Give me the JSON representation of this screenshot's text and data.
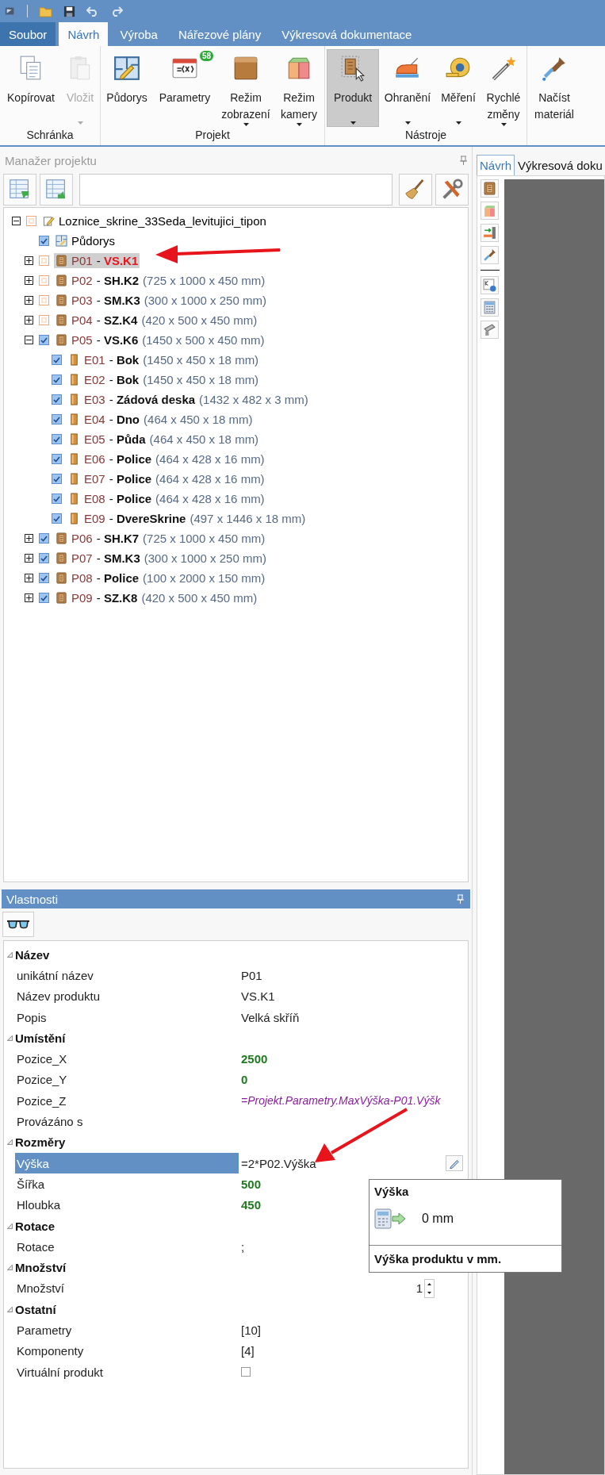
{
  "menu_tabs": [
    {
      "label": "Soubor",
      "kind": "file",
      "selected": false
    },
    {
      "label": "Návrh",
      "kind": "tab",
      "selected": true
    },
    {
      "label": "Výroba",
      "kind": "tab",
      "selected": false
    },
    {
      "label": "Nářezové plány",
      "kind": "tab",
      "selected": false
    },
    {
      "label": "Výkresová dokumentace",
      "kind": "tab",
      "selected": false
    }
  ],
  "ribbon_groups": [
    {
      "label": "Schránka",
      "buttons": [
        {
          "label": "Kopírovat",
          "selected": false,
          "disabled": false,
          "dropdown": false
        },
        {
          "label": "Vložit",
          "selected": false,
          "disabled": true,
          "dropdown": true
        }
      ]
    },
    {
      "label": "Projekt",
      "buttons": [
        {
          "label": "Půdorys",
          "selected": false,
          "disabled": false,
          "dropdown": false
        },
        {
          "label": "Parametry",
          "badge": "58",
          "selected": false,
          "disabled": false,
          "dropdown": false
        },
        {
          "label": "Režim zobrazení",
          "selected": false,
          "disabled": false,
          "dropdown": true
        },
        {
          "label": "Režim kamery",
          "selected": false,
          "disabled": false,
          "dropdown": true
        }
      ]
    },
    {
      "label": "Nástroje",
      "buttons": [
        {
          "label": "Produkt",
          "selected": true,
          "disabled": false,
          "dropdown": true
        },
        {
          "label": "Ohranění",
          "selected": false,
          "disabled": false,
          "dropdown": true
        },
        {
          "label": "Měření",
          "selected": false,
          "disabled": false,
          "dropdown": true
        },
        {
          "label": "Rychlé změny",
          "selected": false,
          "disabled": false,
          "dropdown": true
        }
      ]
    },
    {
      "buttons": [
        {
          "label": "Načíst materiál",
          "selected": false,
          "disabled": false,
          "dropdown": false
        }
      ]
    }
  ],
  "project_manager": {
    "title": "Manažer projektu",
    "tree": {
      "kind": "project",
      "label": "Loznice_skrine_33Seda_levitujici_tipon",
      "checked": false,
      "expanded": true,
      "selected": false,
      "children": [
        {
          "kind": "plan",
          "label": "Půdorys",
          "checked": true,
          "selected": false
        },
        {
          "kind": "product",
          "code": "P01",
          "title": "- **VS.K1**",
          "checked": false,
          "expanded": false,
          "selected": true
        },
        {
          "kind": "product",
          "code": "P02",
          "title": "- **SH.K2**",
          "size": "(725 x 1000 x 450 mm)",
          "checked": false,
          "expanded": false,
          "selected": false
        },
        {
          "kind": "product",
          "code": "P03",
          "title": "- **SM.K3**",
          "size": "(300 x 1000 x 250 mm)",
          "checked": false,
          "expanded": false,
          "selected": false
        },
        {
          "kind": "product",
          "code": "P04",
          "title": "- **SZ.K4**",
          "size": "(420 x 500 x 450 mm)",
          "checked": false,
          "expanded": false,
          "selected": false
        },
        {
          "kind": "product",
          "code": "P05",
          "title": "- **VS.K6**",
          "size": "(1450 x 500 x 450 mm)",
          "checked": true,
          "expanded": true,
          "selected": false,
          "children": [
            {
              "kind": "part",
              "code": "E01",
              "title": "- **Bok**",
              "size": "(1450 x 450 x 18 mm)",
              "checked": true,
              "selected": false
            },
            {
              "kind": "part",
              "code": "E02",
              "title": "- **Bok**",
              "size": "(1450 x 450 x 18 mm)",
              "checked": true,
              "selected": false
            },
            {
              "kind": "part",
              "code": "E03",
              "title": "- **Zádová deska**",
              "size": "(1432 x 482 x 3 mm)",
              "checked": true,
              "selected": false
            },
            {
              "kind": "part",
              "code": "E04",
              "title": "- **Dno**",
              "size": "(464 x 450 x 18 mm)",
              "checked": true,
              "selected": false
            },
            {
              "kind": "part",
              "code": "E05",
              "title": "- **Půda**",
              "size": "(464 x 450 x 18 mm)",
              "checked": true,
              "selected": false
            },
            {
              "kind": "part",
              "code": "E06",
              "title": "- **Police**",
              "size": "(464 x 428 x 16 mm)",
              "checked": true,
              "selected": false
            },
            {
              "kind": "part",
              "code": "E07",
              "title": "- **Police**",
              "size": "(464 x 428 x 16 mm)",
              "checked": true,
              "selected": false
            },
            {
              "kind": "part",
              "code": "E08",
              "title": "- **Police**",
              "size": "(464 x 428 x 16 mm)",
              "checked": true,
              "selected": false
            },
            {
              "kind": "part",
              "code": "E09",
              "title": "- **DvereSkrine**",
              "size": "(497 x 1446 x 18 mm)",
              "checked": true,
              "selected": false
            }
          ]
        },
        {
          "kind": "product",
          "code": "P06",
          "title": "- **SH.K7**",
          "size": "(725 x 1000 x 450 mm)",
          "checked": true,
          "expanded": false,
          "selected": false
        },
        {
          "kind": "product",
          "code": "P07",
          "title": "- **SM.K3**",
          "size": "(300 x 1000 x 250 mm)",
          "checked": true,
          "expanded": false,
          "selected": false
        },
        {
          "kind": "product",
          "code": "P08",
          "title": "- **Police**",
          "size": "(100 x 2000 x 150 mm)",
          "checked": true,
          "expanded": false,
          "selected": false
        },
        {
          "kind": "product",
          "code": "P09",
          "title": "- **SZ.K8**",
          "size": "(420 x 500 x 450 mm)",
          "checked": true,
          "expanded": false,
          "selected": false
        }
      ]
    }
  },
  "properties": {
    "title": "Vlastnosti",
    "categories": [
      {
        "label": "Název",
        "expanded": true,
        "rows": [
          {
            "name": "unikátní název",
            "kind": "text",
            "value": "P01",
            "selected": false
          },
          {
            "name": "Název produktu",
            "kind": "text",
            "value": "VS.K1",
            "selected": false
          },
          {
            "name": "Popis",
            "kind": "text",
            "value": "Velká skříň",
            "selected": false
          }
        ]
      },
      {
        "label": "Umístění",
        "expanded": true,
        "rows": [
          {
            "name": "Pozice_X",
            "kind": "number",
            "value": "2500",
            "selected": false
          },
          {
            "name": "Pozice_Y",
            "kind": "number",
            "value": "0",
            "selected": false
          },
          {
            "name": "Pozice_Z",
            "kind": "formula",
            "value": "=Projekt.Parametry.MaxVýška-P01.Výšk",
            "selected": false
          },
          {
            "name": "Provázáno s",
            "kind": "text",
            "selected": false
          }
        ]
      },
      {
        "label": "Rozměry",
        "expanded": true,
        "rows": [
          {
            "name": "Výška",
            "kind": "text",
            "value": "=2*P02.Výška",
            "selected": true
          },
          {
            "name": "Šířka",
            "kind": "number",
            "value": "500",
            "selected": false
          },
          {
            "name": "Hloubka",
            "kind": "number",
            "value": "450",
            "selected": false
          }
        ]
      },
      {
        "label": "Rotace",
        "expanded": true,
        "rows": [
          {
            "name": "Rotace",
            "kind": "text",
            "value": ";",
            "selected": false
          }
        ]
      },
      {
        "label": "Množství",
        "expanded": true,
        "rows": [
          {
            "name": "Množství",
            "kind": "spinner",
            "value": "1",
            "selected": false
          }
        ]
      },
      {
        "label": "Ostatní",
        "expanded": true,
        "rows": [
          {
            "name": "Parametry",
            "kind": "text",
            "value": "[10]",
            "selected": false
          },
          {
            "name": "Komponenty",
            "kind": "text",
            "value": "[4]",
            "selected": false
          },
          {
            "name": "Virtuální produkt",
            "kind": "checkbox",
            "checked": false,
            "selected": false
          }
        ]
      }
    ]
  },
  "tooltip": {
    "title": "Výška",
    "value": "0 mm",
    "description": "Výška produktu v mm."
  },
  "design_tabs": [
    {
      "label": "Návrh",
      "selected": true
    },
    {
      "label": "Výkresová doku",
      "selected": false
    }
  ]
}
